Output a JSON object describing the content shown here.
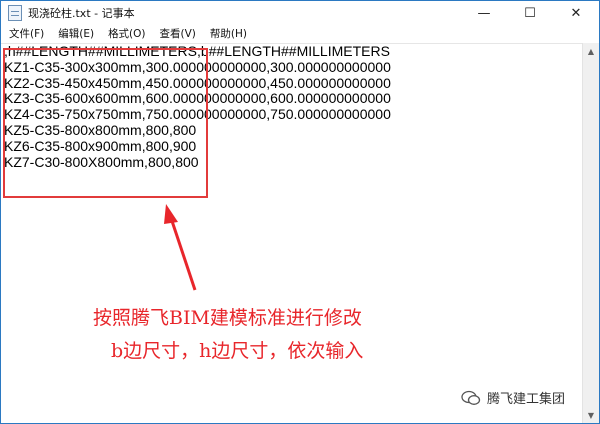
{
  "window": {
    "title": "现浇砼柱.txt - 记事本",
    "controls": {
      "minimize": "—",
      "maximize": "☐",
      "close": "✕"
    }
  },
  "menu": {
    "items": [
      {
        "label": "文件(F)"
      },
      {
        "label": "编辑(E)"
      },
      {
        "label": "格式(O)"
      },
      {
        "label": "查看(V)"
      },
      {
        "label": "帮助(H)"
      }
    ]
  },
  "editor": {
    "lines": [
      ",h##LENGTH##MILLIMETERS,b##LENGTH##MILLIMETERS",
      "KZ1-C35-300x300mm,300.000000000000,300.000000000000",
      "KZ2-C35-450x450mm,450.000000000000,450.000000000000",
      "KZ3-C35-600x600mm,600.000000000000,600.000000000000",
      "KZ4-C35-750x750mm,750.000000000000,750.000000000000",
      "KZ5-C35-800x800mm,800,800",
      "KZ6-C35-800x900mm,800,900",
      "KZ7-C30-800X800mm,800,800"
    ]
  },
  "annotation": {
    "line1": "按照腾飞BIM建模标准进行修改",
    "line2": "b边尺寸，h边尺寸，依次输入",
    "color": "#e8262b"
  },
  "watermark": {
    "text": "腾飞建工集团",
    "icon": "wechat-icon"
  }
}
